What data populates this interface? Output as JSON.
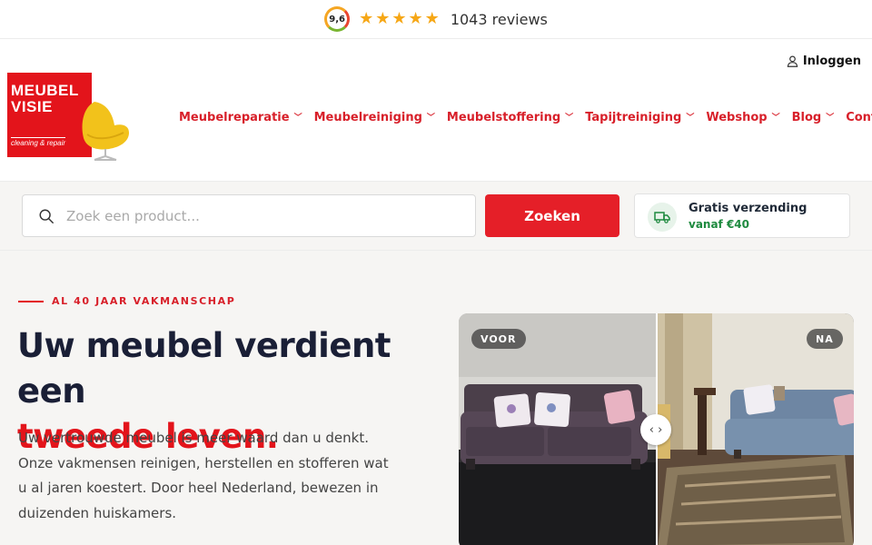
{
  "rating": {
    "score": "9,6",
    "stars": 5,
    "reviews_label": "1043 reviews"
  },
  "header": {
    "login_label": "Inloggen",
    "logo": {
      "line1": "MEUBEL",
      "line2": "VISIE",
      "tagline": "cleaning & repair"
    },
    "nav": [
      {
        "label": "Meubelreparatie",
        "has_dropdown": true
      },
      {
        "label": "Meubelreiniging",
        "has_dropdown": true
      },
      {
        "label": "Meubelstoffering",
        "has_dropdown": true
      },
      {
        "label": "Tapijtreiniging",
        "has_dropdown": true
      },
      {
        "label": "Webshop",
        "has_dropdown": true
      },
      {
        "label": "Blog",
        "has_dropdown": true
      },
      {
        "label": "Contact",
        "has_dropdown": false
      }
    ]
  },
  "search": {
    "placeholder": "Zoek een product...",
    "button_label": "Zoeken"
  },
  "shipping": {
    "title": "Gratis verzending",
    "subtitle": "vanaf €40"
  },
  "hero": {
    "eyebrow": "AL 40 JAAR VAKMANSCHAP",
    "title_line1": "Uw meubel verdient een",
    "title_line2": "tweede leven.",
    "text": "Uw vertrouwde meubel is meer waard dan u denkt. Onze vakmensen reinigen, herstellen en stofferen wat u al jaren koestert. Door heel Nederland, bewezen in duizenden huiskamers.",
    "before_label": "VOOR",
    "after_label": "NA",
    "handle_glyph": "‹ ›"
  },
  "colors": {
    "brand_red": "#e3141b",
    "nav_red": "#d8202a",
    "star_gold": "#f6a716",
    "shipping_green": "#1e8a3f",
    "hero_bg": "#f6f5f3",
    "title_dark": "#1a1f36"
  }
}
